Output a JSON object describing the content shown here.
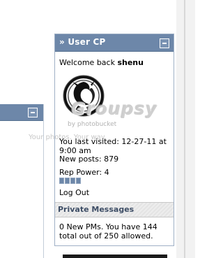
{
  "panel": {
    "title": "» User CP",
    "welcome_prefix": "Welcome back ",
    "username": "shenu",
    "last_visited": "You last visited: 12-27-11 at 9:00 am",
    "new_posts": "New posts: 879",
    "rep_power": "Rep Power: 4",
    "rep_level": 4,
    "logout_label": "Log Out"
  },
  "private_messages": {
    "title": "Private Messages",
    "summary": "0 New PMs. You have 144 total out of 250 allowed."
  },
  "watermark": {
    "logo": "Groupsy",
    "by": "by photobucket",
    "tagline": "Your photos. Your way."
  },
  "colors": {
    "header": "#6d87a9",
    "pm_header": "#e6e6e6"
  },
  "icons": [
    "minimize-icon",
    "dragon-avatar"
  ]
}
